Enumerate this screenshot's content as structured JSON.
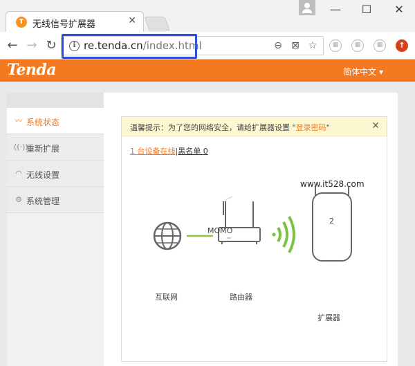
{
  "browser": {
    "tab_title": "无线信号扩展器",
    "tab_favicon": "Tenda",
    "url_host": "re.tenda.cn",
    "url_path": "/index.html"
  },
  "header": {
    "logo": "Tenda",
    "language": "简体中文",
    "accent_color": "#f47920"
  },
  "sidebar": {
    "items": [
      {
        "label": "系统状态",
        "icon": "pulse-icon",
        "active": true
      },
      {
        "label": "重新扩展",
        "icon": "signal-icon",
        "active": false
      },
      {
        "label": "无线设置",
        "icon": "wifi-icon",
        "active": false
      },
      {
        "label": "系统管理",
        "icon": "gear-icon",
        "active": false
      }
    ]
  },
  "notice": {
    "prefix": "温馨提示：为了您的网络安全，请给扩展器设置 \"",
    "link": "登录密码",
    "suffix": "\""
  },
  "devices": {
    "online": "1 台设备在线",
    "blacklist": "黑名单 0"
  },
  "watermark": "www.it528.com",
  "topology": {
    "internet_label": "互联网",
    "router_ssid": "MOMO",
    "router_label": "路由器",
    "extender_clients": "2",
    "extender_label": "扩展器"
  }
}
